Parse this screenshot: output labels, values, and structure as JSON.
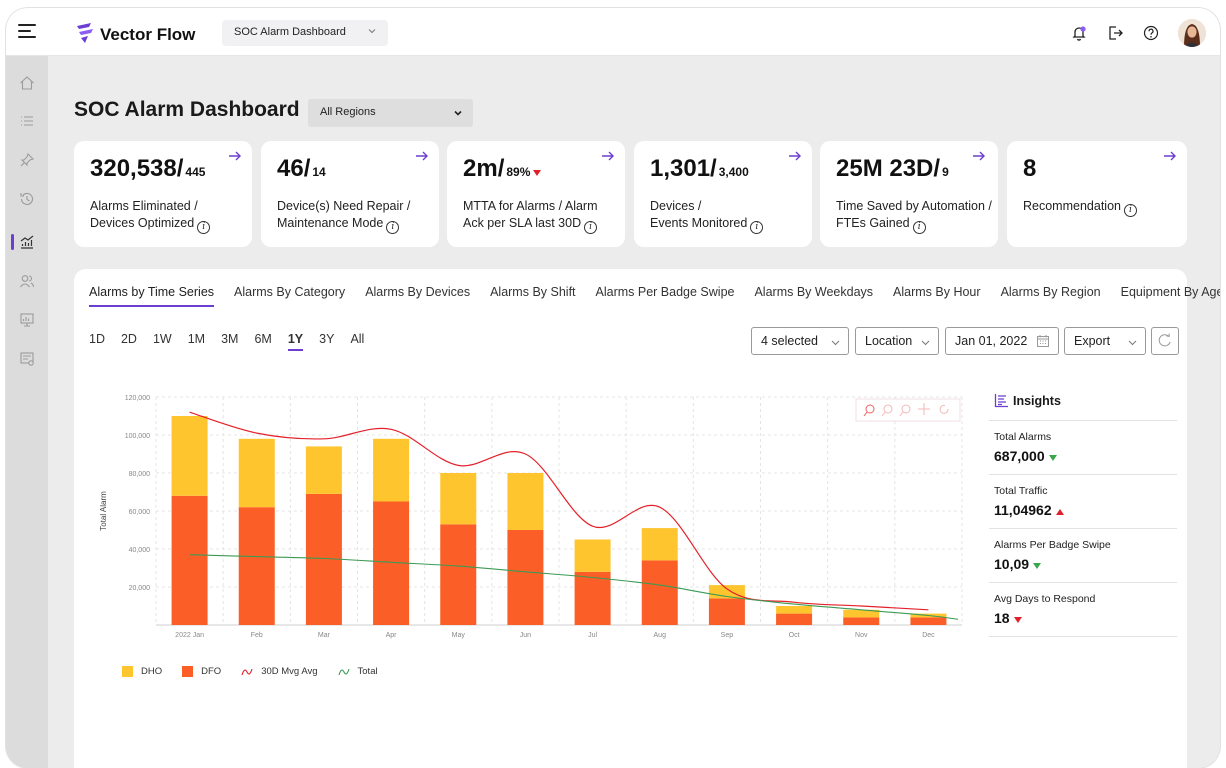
{
  "app": {
    "brand": "Vector Flow",
    "dashboard_select": "SOC Alarm Dashboard"
  },
  "page": {
    "title": "SOC Alarm Dashboard",
    "region_select": "All Regions"
  },
  "kpis": [
    {
      "main": "320,538/",
      "sub": "445",
      "line1": "Alarms Eliminated /",
      "line2": "Devices Optimized"
    },
    {
      "main": "46/",
      "sub": "14",
      "line1": "Device(s) Need Repair /",
      "line2": "Maintenance Mode"
    },
    {
      "main": "2m/",
      "sub": "89%",
      "line1": "MTTA for Alarms / Alarm",
      "line2": "Ack per SLA last 30D"
    },
    {
      "main": "1,301/",
      "sub": "3,400",
      "line1": "Devices /",
      "line2": "Events Monitored"
    },
    {
      "main": "25M 23D/",
      "sub": "9",
      "line1": "Time Saved by Automation /",
      "line2": "FTEs Gained"
    },
    {
      "main": "8",
      "sub": "",
      "line1": "Recommendation",
      "line2": ""
    }
  ],
  "tabs": [
    "Alarms by Time Series",
    "Alarms By Category",
    "Alarms By Devices",
    "Alarms By Shift",
    "Alarms Per Badge Swipe",
    "Alarms By Weekdays",
    "Alarms By Hour",
    "Alarms By Region",
    "Equipment By Age"
  ],
  "ranges": [
    "1D",
    "2D",
    "1W",
    "1M",
    "3M",
    "6M",
    "1Y",
    "3Y",
    "All"
  ],
  "active_range": "1Y",
  "controls": {
    "selected": "4 selected",
    "location": "Location",
    "date": "Jan 01, 2022",
    "export": "Export"
  },
  "insights": {
    "title": "Insights",
    "items": [
      {
        "label": "Total Alarms",
        "value": "687,000",
        "trend": "down-green"
      },
      {
        "label": "Total Traffic",
        "value": "11,04962",
        "trend": "up-red"
      },
      {
        "label": "Alarms Per Badge Swipe",
        "value": "10,09",
        "trend": "down-green"
      },
      {
        "label": "Avg Days to Respond",
        "value": "18",
        "trend": "down-red"
      }
    ]
  },
  "legend": [
    "DHO",
    "DFO",
    "30D Mvg Avg",
    "Total"
  ],
  "colors": {
    "dho": "#ffc52f",
    "dfo": "#fb5f27",
    "avg": "#e4212a",
    "total": "#3c9a55",
    "accent": "#6c3fd1"
  },
  "chart_data": {
    "type": "bar",
    "ylabel": "Total Alarm",
    "ylim": [
      0,
      120000
    ],
    "yticks": [
      "120,000",
      "100,000",
      "80,000",
      "60,000",
      "40,000",
      "20,000"
    ],
    "categories": [
      "2022 Jan",
      "Feb",
      "Mar",
      "Apr",
      "May",
      "Jun",
      "Jul",
      "Aug",
      "Sep",
      "Oct",
      "Nov",
      "Dec"
    ],
    "series": [
      {
        "name": "DFO",
        "values": [
          68000,
          62000,
          69000,
          65000,
          53000,
          50000,
          28000,
          34000,
          14000,
          6000,
          4000,
          4000
        ]
      },
      {
        "name": "DHO",
        "values": [
          42000,
          36000,
          25000,
          33000,
          27000,
          30000,
          17000,
          17000,
          7000,
          4000,
          4000,
          2000
        ]
      },
      {
        "name": "30D Mvg Avg",
        "values": [
          112000,
          101000,
          98000,
          103000,
          84000,
          90000,
          52000,
          62000,
          19000,
          12000,
          10000,
          8000
        ]
      },
      {
        "name": "Total",
        "values": [
          37000,
          36000,
          35000,
          33000,
          31000,
          28000,
          25000,
          21000,
          15000,
          11000,
          8000,
          5000
        ]
      }
    ],
    "grid": true,
    "legend_position": "bottom-left"
  }
}
